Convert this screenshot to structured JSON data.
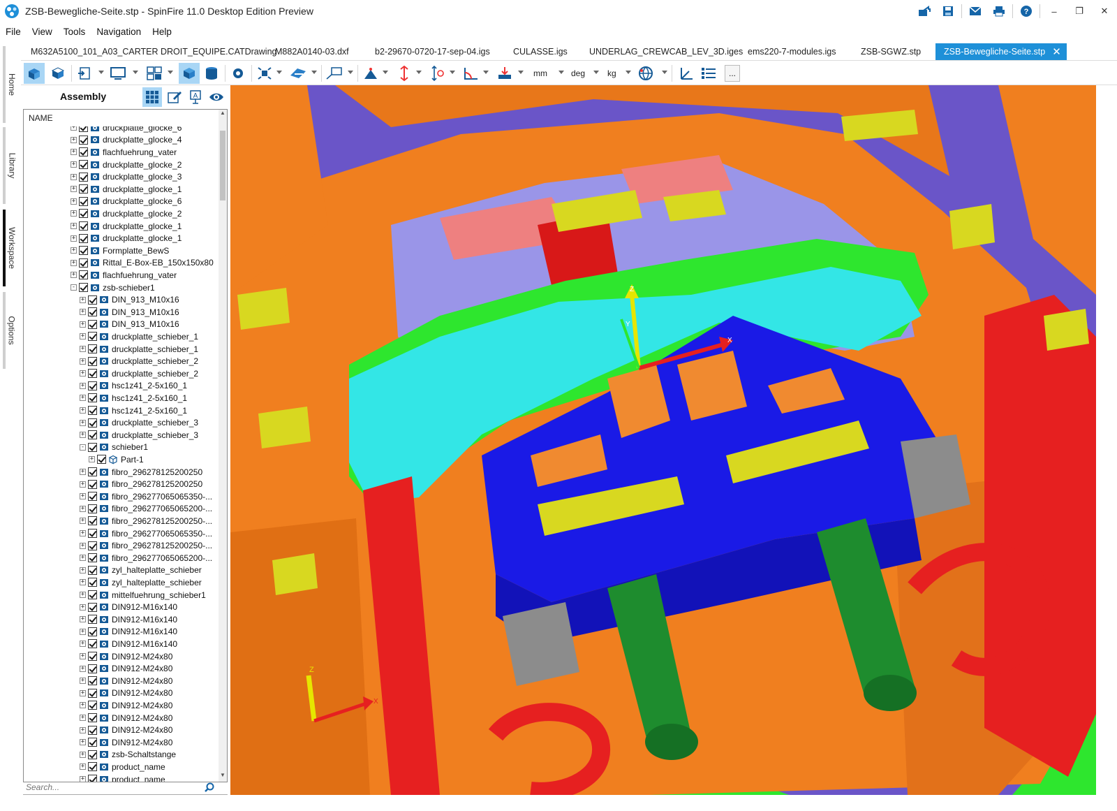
{
  "window": {
    "title": "ZSB-Bewegliche-Seite.stp - SpinFire 11.0 Desktop Edition Preview",
    "controls": [
      "minimize",
      "restore",
      "close"
    ]
  },
  "titlebar_icons": [
    "share-icon",
    "save-icon",
    "mail-icon",
    "print-icon",
    "help-icon"
  ],
  "menu": [
    "File",
    "View",
    "Tools",
    "Navigation",
    "Help"
  ],
  "rail": [
    "Home",
    "Library",
    "Workspace",
    "Options"
  ],
  "rail_active": "Workspace",
  "doc_tabs": [
    "M632A5100_101_A03_CARTER DROIT_EQUIPE.CATDrawing",
    "M882A0140-03.dxf",
    "b2-29670-0720-17-sep-04.igs",
    "CULASSE.igs",
    "UNDERLAG_CREWCAB_LEV_3D.iges",
    "ems220-7-modules.igs",
    "ZSB-SGWZ.stp",
    "ZSB-Bewegliche-Seite.stp"
  ],
  "active_tab": "ZSB-Bewegliche-Seite.stp",
  "toolbar": {
    "units_length": "mm",
    "units_angle": "deg",
    "units_mass": "kg",
    "more_label": "..."
  },
  "panel": {
    "title": "Assembly",
    "column_header": "NAME",
    "search_placeholder": "Search..."
  },
  "tree": [
    {
      "level": 0,
      "label": "druckplatte_glocke_6",
      "expander": "+",
      "icon": "assembly"
    },
    {
      "level": 0,
      "label": "druckplatte_glocke_4",
      "expander": "+",
      "icon": "assembly"
    },
    {
      "level": 0,
      "label": "flachfuehrung_vater",
      "expander": "+",
      "icon": "assembly"
    },
    {
      "level": 0,
      "label": "druckplatte_glocke_2",
      "expander": "+",
      "icon": "assembly"
    },
    {
      "level": 0,
      "label": "druckplatte_glocke_3",
      "expander": "+",
      "icon": "assembly"
    },
    {
      "level": 0,
      "label": "druckplatte_glocke_1",
      "expander": "+",
      "icon": "assembly"
    },
    {
      "level": 0,
      "label": "druckplatte_glocke_6",
      "expander": "+",
      "icon": "assembly"
    },
    {
      "level": 0,
      "label": "druckplatte_glocke_2",
      "expander": "+",
      "icon": "assembly"
    },
    {
      "level": 0,
      "label": "druckplatte_glocke_1",
      "expander": "+",
      "icon": "assembly"
    },
    {
      "level": 0,
      "label": "druckplatte_glocke_1",
      "expander": "+",
      "icon": "assembly"
    },
    {
      "level": 0,
      "label": "Formplatte_BewS",
      "expander": "+",
      "icon": "assembly"
    },
    {
      "level": 0,
      "label": "Rittal_E-Box-EB_150x150x80",
      "expander": "+",
      "icon": "assembly"
    },
    {
      "level": 0,
      "label": "flachfuehrung_vater",
      "expander": "+",
      "icon": "assembly"
    },
    {
      "level": 0,
      "label": "zsb-schieber1",
      "expander": "-",
      "icon": "assembly"
    },
    {
      "level": 1,
      "label": "DIN_913_M10x16",
      "expander": "+",
      "icon": "assembly"
    },
    {
      "level": 1,
      "label": "DIN_913_M10x16",
      "expander": "+",
      "icon": "assembly"
    },
    {
      "level": 1,
      "label": "DIN_913_M10x16",
      "expander": "+",
      "icon": "assembly"
    },
    {
      "level": 1,
      "label": "druckplatte_schieber_1",
      "expander": "+",
      "icon": "assembly"
    },
    {
      "level": 1,
      "label": "druckplatte_schieber_1",
      "expander": "+",
      "icon": "assembly"
    },
    {
      "level": 1,
      "label": "druckplatte_schieber_2",
      "expander": "+",
      "icon": "assembly"
    },
    {
      "level": 1,
      "label": "druckplatte_schieber_2",
      "expander": "+",
      "icon": "assembly"
    },
    {
      "level": 1,
      "label": "hsc1z41_2-5x160_1",
      "expander": "+",
      "icon": "assembly"
    },
    {
      "level": 1,
      "label": "hsc1z41_2-5x160_1",
      "expander": "+",
      "icon": "assembly"
    },
    {
      "level": 1,
      "label": "hsc1z41_2-5x160_1",
      "expander": "+",
      "icon": "assembly"
    },
    {
      "level": 1,
      "label": "druckplatte_schieber_3",
      "expander": "+",
      "icon": "assembly"
    },
    {
      "level": 1,
      "label": "druckplatte_schieber_3",
      "expander": "+",
      "icon": "assembly"
    },
    {
      "level": 1,
      "label": "schieber1",
      "expander": "-",
      "icon": "assembly"
    },
    {
      "level": 2,
      "label": "Part-1",
      "expander": "+",
      "icon": "part"
    },
    {
      "level": 1,
      "label": "fibro_296278125200250",
      "expander": "+",
      "icon": "assembly"
    },
    {
      "level": 1,
      "label": "fibro_296278125200250",
      "expander": "+",
      "icon": "assembly"
    },
    {
      "level": 1,
      "label": "fibro_296277065065350-...",
      "expander": "+",
      "icon": "assembly"
    },
    {
      "level": 1,
      "label": "fibro_296277065065200-...",
      "expander": "+",
      "icon": "assembly"
    },
    {
      "level": 1,
      "label": "fibro_296278125200250-...",
      "expander": "+",
      "icon": "assembly"
    },
    {
      "level": 1,
      "label": "fibro_296277065065350-...",
      "expander": "+",
      "icon": "assembly"
    },
    {
      "level": 1,
      "label": "fibro_296278125200250-...",
      "expander": "+",
      "icon": "assembly"
    },
    {
      "level": 1,
      "label": "fibro_296277065065200-...",
      "expander": "+",
      "icon": "assembly"
    },
    {
      "level": 1,
      "label": "zyl_halteplatte_schieber",
      "expander": "+",
      "icon": "assembly"
    },
    {
      "level": 1,
      "label": "zyl_halteplatte_schieber",
      "expander": "+",
      "icon": "assembly"
    },
    {
      "level": 1,
      "label": "mittelfuehrung_schieber1",
      "expander": "+",
      "icon": "assembly"
    },
    {
      "level": 1,
      "label": "DIN912-M16x140",
      "expander": "+",
      "icon": "assembly"
    },
    {
      "level": 1,
      "label": "DIN912-M16x140",
      "expander": "+",
      "icon": "assembly"
    },
    {
      "level": 1,
      "label": "DIN912-M16x140",
      "expander": "+",
      "icon": "assembly"
    },
    {
      "level": 1,
      "label": "DIN912-M16x140",
      "expander": "+",
      "icon": "assembly"
    },
    {
      "level": 1,
      "label": "DIN912-M24x80",
      "expander": "+",
      "icon": "assembly"
    },
    {
      "level": 1,
      "label": "DIN912-M24x80",
      "expander": "+",
      "icon": "assembly"
    },
    {
      "level": 1,
      "label": "DIN912-M24x80",
      "expander": "+",
      "icon": "assembly"
    },
    {
      "level": 1,
      "label": "DIN912-M24x80",
      "expander": "+",
      "icon": "assembly"
    },
    {
      "level": 1,
      "label": "DIN912-M24x80",
      "expander": "+",
      "icon": "assembly"
    },
    {
      "level": 1,
      "label": "DIN912-M24x80",
      "expander": "+",
      "icon": "assembly"
    },
    {
      "level": 1,
      "label": "DIN912-M24x80",
      "expander": "+",
      "icon": "assembly"
    },
    {
      "level": 1,
      "label": "DIN912-M24x80",
      "expander": "+",
      "icon": "assembly"
    },
    {
      "level": 1,
      "label": "zsb-Schaltstange",
      "expander": "+",
      "icon": "assembly"
    },
    {
      "level": 1,
      "label": "product_name",
      "expander": "+",
      "icon": "assembly"
    },
    {
      "level": 1,
      "label": "product_name",
      "expander": "+",
      "icon": "assembly"
    }
  ],
  "viewport": {
    "axis_labels": {
      "x": "X",
      "y": "Y",
      "z": "Z"
    },
    "colors": {
      "background": "#6a55c8",
      "orange": "#f07f1f",
      "green": "#2ee62e",
      "blue": "#1a1ae6",
      "cyan": "#33e6e6",
      "red": "#e62020",
      "yellow": "#d8d820",
      "gray": "#8c8c8c",
      "lavender": "#9a95e8",
      "pink": "#ee8080"
    }
  },
  "accent_color": "#1e90d8"
}
